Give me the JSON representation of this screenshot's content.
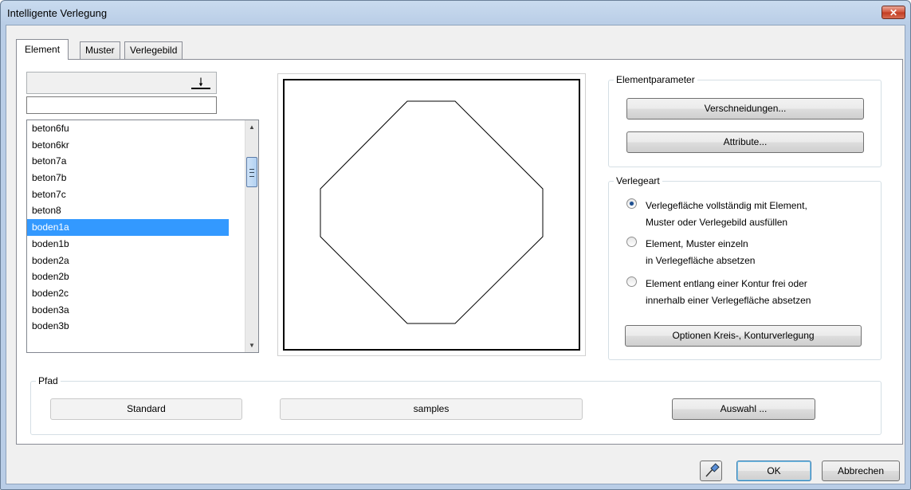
{
  "window": {
    "title": "Intelligente Verlegung",
    "close_label": "✕"
  },
  "tabs": [
    {
      "label": "Element"
    },
    {
      "label": "Muster"
    },
    {
      "label": "Verlegebild"
    }
  ],
  "element_list": {
    "combo_value": "",
    "filter_value": "",
    "items": [
      "beton6fu",
      "beton6kr",
      "beton7a",
      "beton7b",
      "beton7c",
      "beton8",
      "boden1a",
      "boden1b",
      "boden2a",
      "boden2b",
      "boden2c",
      "boden3a",
      "boden3b"
    ],
    "selected": "boden1a"
  },
  "elementparameter": {
    "label": "Elementparameter",
    "verschneidungen": "Verschneidungen...",
    "attribute": "Attribute..."
  },
  "verlegeart": {
    "label": "Verlegeart",
    "options": [
      {
        "line1": "Verlegefläche vollständig mit Element,",
        "line2": "Muster oder Verlegebild ausfüllen",
        "checked": true
      },
      {
        "line1": "Element, Muster einzeln",
        "line2": "in Verlegefläche absetzen",
        "checked": false
      },
      {
        "line1": "Element entlang einer Kontur frei oder",
        "line2": "innerhalb einer Verlegefläche absetzen",
        "checked": false
      }
    ],
    "optionen_button": "Optionen Kreis-, Konturverlegung"
  },
  "pfad": {
    "label": "Pfad",
    "standard": "Standard",
    "samples": "samples",
    "auswahl": "Auswahl ..."
  },
  "footer": {
    "ok": "OK",
    "cancel": "Abbrechen"
  },
  "colors": {
    "selection": "#3399ff",
    "title_bar": "#b9cde6",
    "close_button": "#c13b21"
  }
}
